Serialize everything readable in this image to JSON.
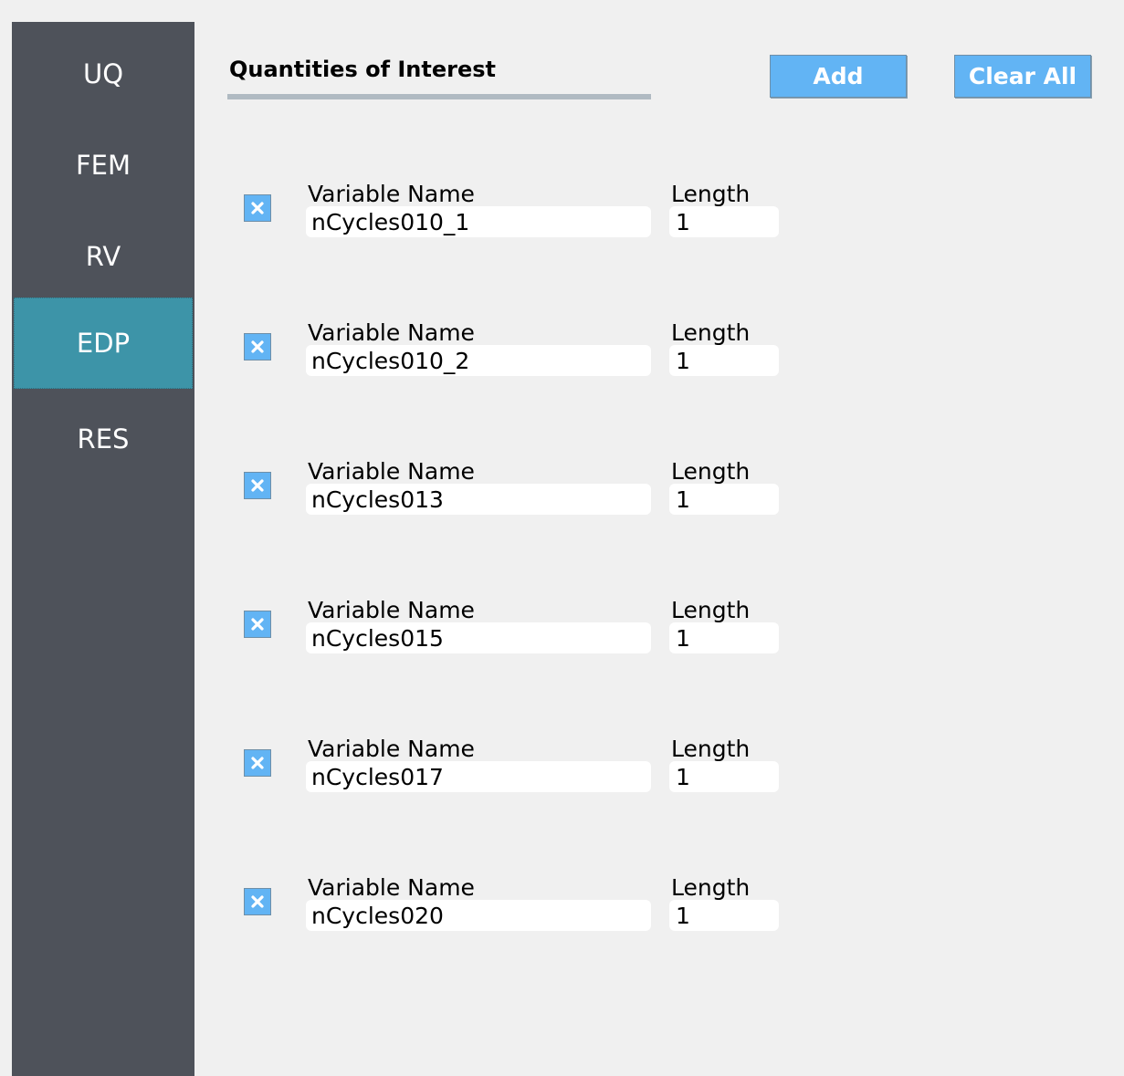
{
  "sidebar": {
    "items": [
      {
        "label": "UQ"
      },
      {
        "label": "FEM"
      },
      {
        "label": "RV"
      },
      {
        "label": "EDP",
        "active": true
      },
      {
        "label": "RES"
      }
    ]
  },
  "header": {
    "title": "Quantities of Interest",
    "add_label": "Add",
    "clear_label": "Clear All"
  },
  "quantities": [
    {
      "name_label": "Variable Name",
      "name": "nCycles010_1",
      "length_label": "Length",
      "length": "1"
    },
    {
      "name_label": "Variable Name",
      "name": "nCycles010_2",
      "length_label": "Length",
      "length": "1"
    },
    {
      "name_label": "Variable Name",
      "name": "nCycles013",
      "length_label": "Length",
      "length": "1"
    },
    {
      "name_label": "Variable Name",
      "name": "nCycles015",
      "length_label": "Length",
      "length": "1"
    },
    {
      "name_label": "Variable Name",
      "name": "nCycles017",
      "length_label": "Length",
      "length": "1"
    },
    {
      "name_label": "Variable Name",
      "name": "nCycles020",
      "length_label": "Length",
      "length": "1"
    }
  ],
  "icons": {
    "remove": "close-icon"
  },
  "colors": {
    "sidebar": "#4e525a",
    "active_nav": "#3d94a8",
    "button": "#62b4f4",
    "background": "#f0f0f0"
  }
}
